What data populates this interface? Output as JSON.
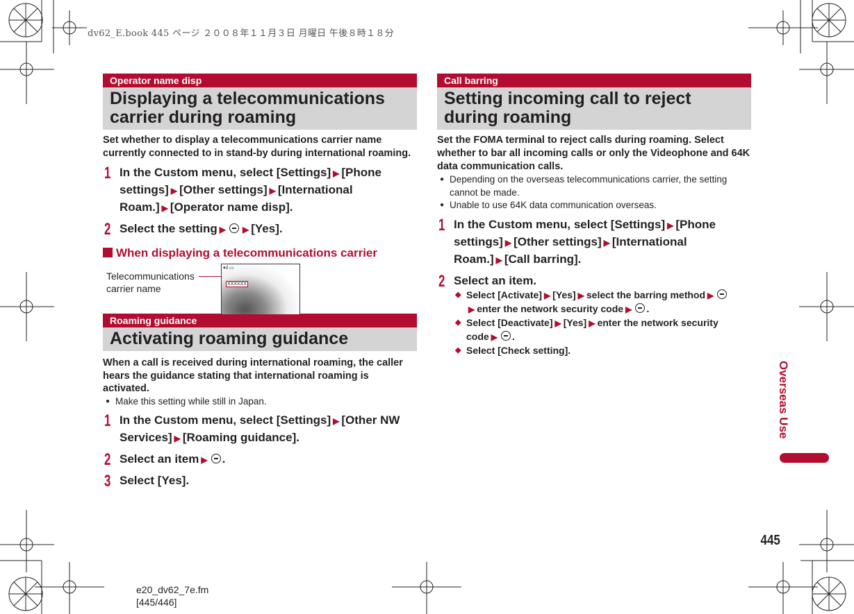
{
  "header_line": "dv62_E.book  445 ページ  ２００８年１１月３日  月曜日  午後８時１８分",
  "left": {
    "s1": {
      "band": "Operator name disp",
      "title": "Displaying a telecommunications carrier during roaming",
      "intro": "Set whether to display a telecommunications carrier name currently connected to in stand-by during international roaming.",
      "step1": {
        "num": "1",
        "pre": "In the Custom menu, select [Settings]",
        "a": "[Phone settings]",
        "b": "[Other settings]",
        "c": "[International Roam.]",
        "d": "[Operator name disp]."
      },
      "step2": {
        "num": "2",
        "pre": "Select the setting",
        "post": "[Yes]."
      },
      "subhead": "When displaying a telecommunications carrier",
      "callout": "Telecommunications carrier name",
      "screen_text": "XXXXXX"
    },
    "s2": {
      "band": "Roaming guidance",
      "title": "Activating roaming guidance",
      "intro": "When a call is received during international roaming, the caller hears the guidance stating that international roaming is activated.",
      "bullet": "Make this setting while still in Japan.",
      "step1": {
        "num": "1",
        "pre": "In the Custom menu, select [Settings]",
        "a": "[Other NW Services]",
        "b": "[Roaming guidance]."
      },
      "step2": {
        "num": "2",
        "pre": "Select an item",
        "post": "."
      },
      "step3": {
        "num": "3",
        "text": "Select [Yes]."
      }
    }
  },
  "right": {
    "band": "Call barring",
    "title": "Setting incoming call to reject during roaming",
    "intro": "Set the FOMA terminal to reject calls during roaming. Select whether to bar all incoming calls or only the Videophone and 64K data communication calls.",
    "bullets": [
      "Depending on the overseas telecommunications carrier, the setting cannot be made.",
      "Unable to use 64K data communication overseas."
    ],
    "step1": {
      "num": "1",
      "pre": "In the Custom menu, select [Settings]",
      "a": "[Phone settings]",
      "b": "[Other settings]",
      "c": "[International Roam.]",
      "d": "[Call barring]."
    },
    "step2": {
      "num": "2",
      "text": "Select an item."
    },
    "subs": {
      "a1": "Select [Activate]",
      "a2": "[Yes]",
      "a3": "select the barring method",
      "a4": "enter the network security code",
      "a5": ".",
      "b1": "Select [Deactivate]",
      "b2": "[Yes]",
      "b3": "enter the network security code",
      "b4": ".",
      "c1": "Select [Check setting]."
    }
  },
  "side_tab": "Overseas Use",
  "page_number": "445",
  "footer": {
    "file": "e20_dv62_7e.fm",
    "pages": "[445/446]"
  },
  "colors": {
    "accent": "#b20d30",
    "section_bg": "#d4d4d4"
  }
}
